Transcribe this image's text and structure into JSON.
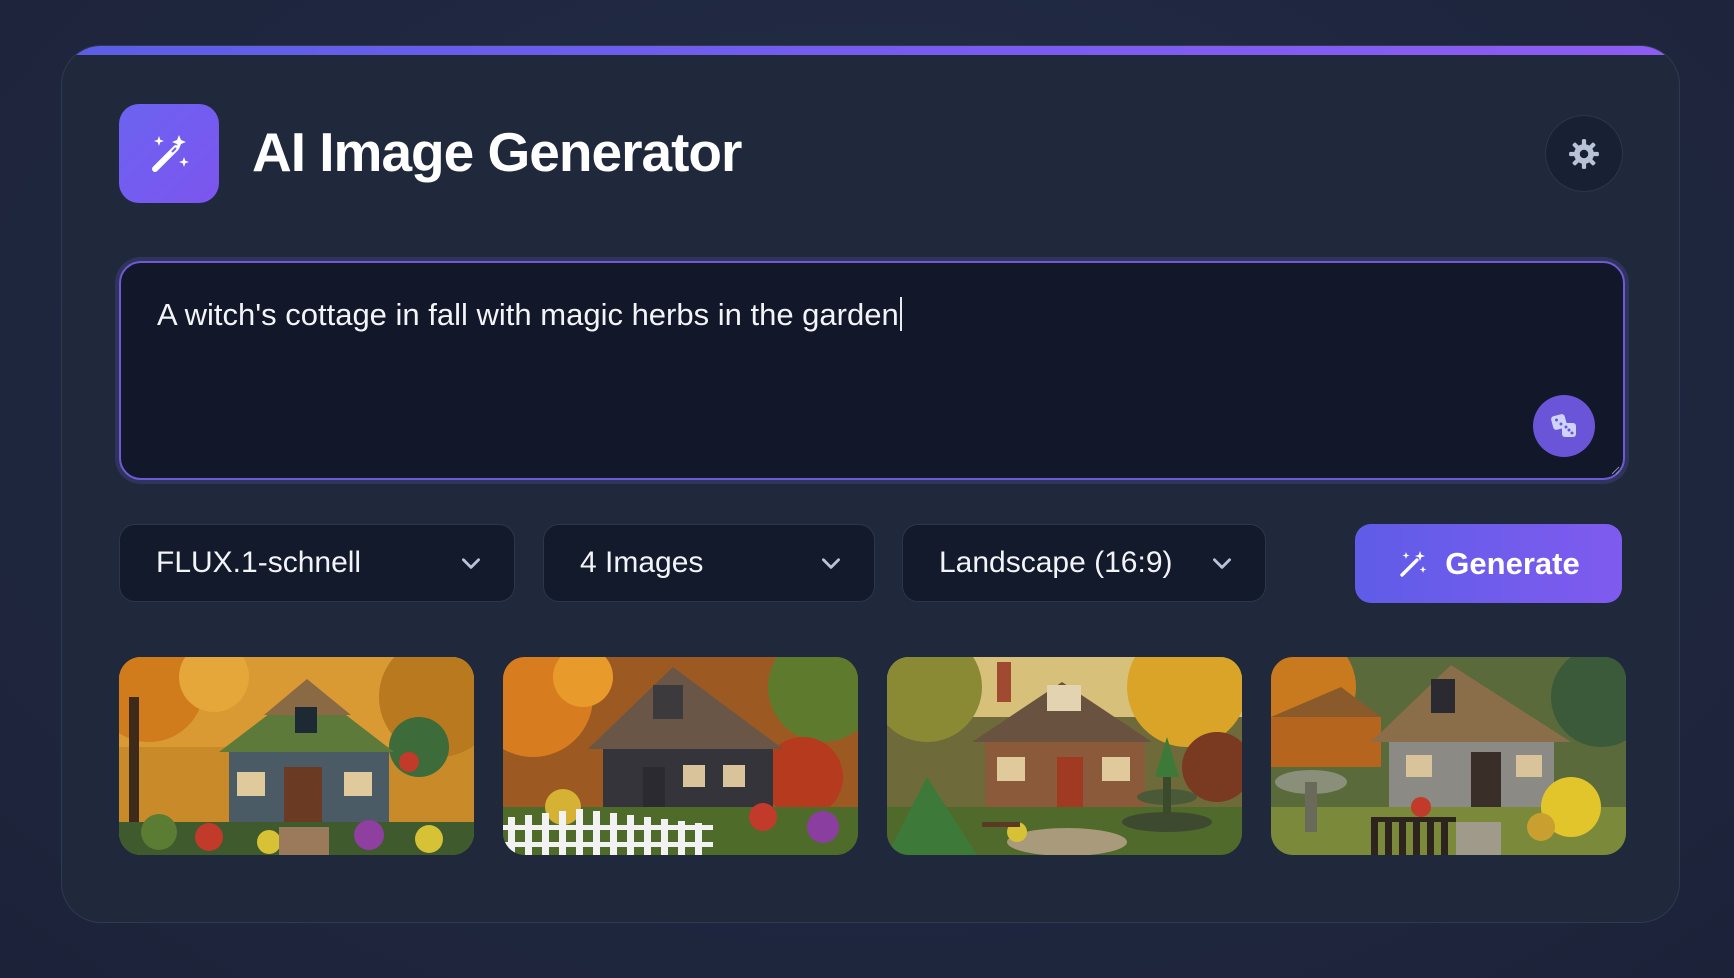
{
  "app": {
    "title": "AI Image Generator"
  },
  "header": {
    "logo_icon": "magic-wand-sparkles-icon",
    "theme_toggle_icon": "gear-icon"
  },
  "prompt": {
    "value": "A witch's cottage in fall with magic herbs in the garden",
    "random_prompt_icon": "dice-icon"
  },
  "controls": {
    "model_select": {
      "value": "FLUX.1-schnell"
    },
    "count_select": {
      "value": "4 Images"
    },
    "aspect_select": {
      "value": "Landscape (16:9)"
    },
    "generate_label": "Generate",
    "generate_icon": "magic-wand-icon"
  },
  "colors": {
    "accent": "#6b5cf0",
    "accent_end": "#8e5cf2",
    "card_bg": "#1f293b",
    "page_bg": "#232b42",
    "input_bg": "#121729"
  },
  "gallery": {
    "images": [
      {
        "name": "generated-image-1"
      },
      {
        "name": "generated-image-2"
      },
      {
        "name": "generated-image-3"
      },
      {
        "name": "generated-image-4"
      }
    ]
  }
}
